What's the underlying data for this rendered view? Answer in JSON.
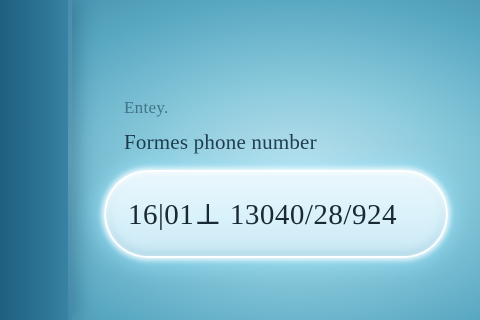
{
  "form": {
    "hint_label": "Entey.",
    "field_label": "Formes phone number",
    "phone_value": "16|01⊥ 13040/28/924"
  }
}
